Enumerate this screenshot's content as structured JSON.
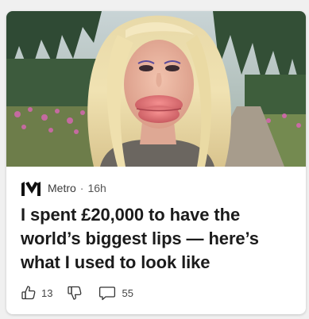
{
  "card": {
    "image_alt": "Woman with long blonde hair and very large lips standing on a path outdoors",
    "source": "Metro",
    "separator": "·",
    "age": "16h",
    "headline": "I spent £20,000 to have the world’s biggest lips — here’s what I used to look like",
    "likes": "13",
    "comments": "55"
  },
  "icons": {
    "source_logo": "metro-logo-icon",
    "like": "thumbs-up-icon",
    "dislike": "thumbs-down-icon",
    "comment": "comment-icon"
  }
}
